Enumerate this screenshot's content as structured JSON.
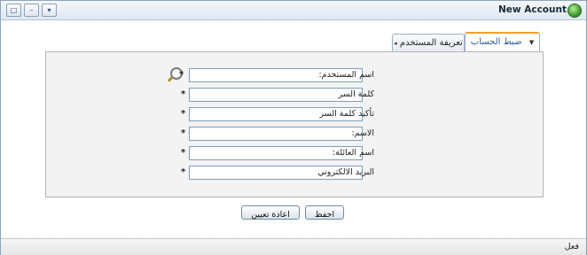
{
  "window": {
    "title": "New Account",
    "status": "فعل",
    "buttons": [
      "□",
      "–",
      "▾"
    ]
  },
  "tabs": [
    {
      "label": "ضبط الحساب",
      "arrow": "▼",
      "active": true
    },
    {
      "label": "تعريفة المستخدم",
      "arrow": "◂",
      "active": false
    }
  ],
  "form": {
    "fields": [
      {
        "label": "اسم المستخدم:",
        "marker": "*",
        "value": ""
      },
      {
        "label": "كلمة السر",
        "marker": "*",
        "value": ""
      },
      {
        "label": "تأكيد كلمة السر",
        "marker": "*",
        "value": ""
      },
      {
        "label": "الاسم:",
        "marker": "*",
        "value": ""
      },
      {
        "label": "اسم العائلة:",
        "marker": "*",
        "value": ""
      },
      {
        "label": "البريد الالكتروني",
        "marker": "*",
        "value": ""
      }
    ]
  },
  "actions": {
    "reset_label": "اعادة تعيين",
    "save_label": "احفظ"
  }
}
